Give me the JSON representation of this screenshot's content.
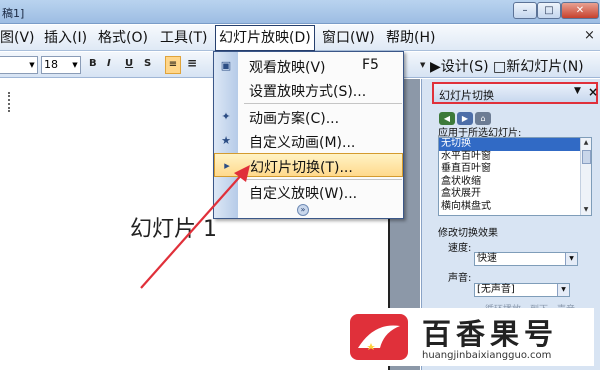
{
  "window": {
    "title_fragment": "稿1]",
    "buttons": {
      "minimize": "–",
      "maximize": "□",
      "close": "✕"
    }
  },
  "menubar": {
    "items": [
      {
        "label": "图(V)"
      },
      {
        "label": "插入(I)"
      },
      {
        "label": "格式(O)"
      },
      {
        "label": "工具(T)"
      },
      {
        "label": "幻灯片放映(D)"
      },
      {
        "label": "窗口(W)"
      },
      {
        "label": "帮助(H)"
      }
    ],
    "close": "×"
  },
  "toolbar": {
    "font_size": "18",
    "bold": "B",
    "italic": "I",
    "underline": "U",
    "shadow": "S",
    "design": "设计(S)",
    "new_slide": "新幻灯片(N)"
  },
  "dropdown": {
    "items": [
      {
        "label": "观看放映(V)",
        "shortcut": "F5",
        "icon": "slideshow-icon"
      },
      {
        "label": "设置放映方式(S)...",
        "shortcut": "",
        "icon": ""
      },
      {
        "label": "动画方案(C)...",
        "shortcut": "",
        "icon": "animation-scheme-icon"
      },
      {
        "label": "自定义动画(M)...",
        "shortcut": "",
        "icon": "custom-animation-icon"
      },
      {
        "label": "幻灯片切换(T)...",
        "shortcut": "",
        "icon": "slide-transition-icon",
        "highlighted": true
      },
      {
        "label": "自定义放映(W)...",
        "shortcut": "",
        "icon": ""
      }
    ],
    "more": "»"
  },
  "slide": {
    "title": "幻灯片 1"
  },
  "taskpane": {
    "title": "幻灯片切换",
    "apply_label": "应用于所选幻灯片:",
    "transitions": [
      "无切换",
      "水平百叶窗",
      "垂直百叶窗",
      "盒状收缩",
      "盒状展开",
      "横向棋盘式"
    ],
    "modify_label": "修改切换效果",
    "speed_label": "速度:",
    "speed_value": "快速",
    "sound_label": "声音:",
    "sound_value": "[无声音]",
    "faded_text": "循环播放，到下一声音"
  },
  "watermark": {
    "brand": "百香果号",
    "url": "huangjinbaixiangguo.com"
  },
  "colors": {
    "accent_red": "#e0303a",
    "menu_highlight": "#ffd98c",
    "selection_blue": "#316ac5"
  }
}
